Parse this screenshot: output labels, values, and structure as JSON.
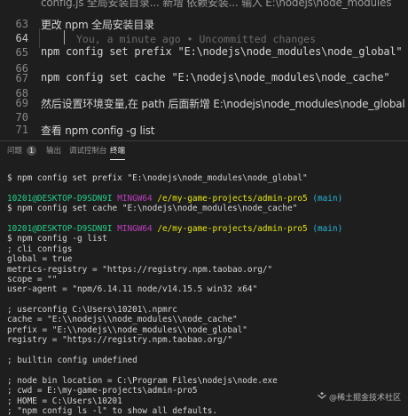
{
  "editor": {
    "top_partial": "config.js  全局安装目录... 新增  依赖安装... 输入 E:\\nodejs\\node_modules",
    "lines": [
      {
        "num": "63",
        "text": "更改 npm 全局安装目录",
        "active": false
      },
      {
        "num": "64",
        "text": "",
        "active": true
      },
      {
        "num": "65",
        "text": "npm config set prefix \"E:\\nodejs\\node_modules\\node_global\"",
        "active": false
      },
      {
        "num": "66",
        "text": "",
        "active": false
      },
      {
        "num": "67",
        "text": "npm config set cache \"E:\\nodejs\\node_modules\\node_cache\"",
        "active": false
      },
      {
        "num": "68",
        "text": "",
        "active": false
      },
      {
        "num": "69",
        "text": "然后设置环境变量,在 path 后面新增 E:\\nodejs\\node_modules\\node_global",
        "active": false
      },
      {
        "num": "70",
        "text": "",
        "active": false
      },
      {
        "num": "71",
        "text": "查看 npm config -g list",
        "active": false
      }
    ],
    "blame": "You, a minute ago • Uncommitted changes"
  },
  "panel": {
    "tabs": [
      {
        "label": "问题"
      },
      {
        "label": "输出"
      },
      {
        "label": "调试控制台"
      },
      {
        "label": "终端"
      }
    ],
    "problems_count": "1"
  },
  "terminal": {
    "cmd1": "$ npm config set prefix \"E:\\nodejs\\node_modules\\node_global\"",
    "prompt_user": "10201@DESKTOP-D9SDN9I",
    "prompt_shell": "MINGW64",
    "prompt_path": "/e/my-game-projects/admin-pro5",
    "prompt_branch": "(main)",
    "cmd2": "$ npm config set cache \"E:\\nodejs\\node_modules\\node_cache\"",
    "cmd3": "$ npm config -g list",
    "output": [
      "; cli configs",
      "global = true",
      "metrics-registry = \"https://registry.npm.taobao.org/\"",
      "scope = \"\"",
      "user-agent = \"npm/6.14.11 node/v14.15.5 win32 x64\"",
      "",
      "; userconfig C:\\Users\\10201\\.npmrc",
      "cache = \"E:\\\\nodejs\\\\node_modules\\\\node_cache\"",
      "prefix = \"E:\\\\nodejs\\\\node_modules\\\\node_global\"",
      "registry = \"https://registry.npm.taobao.org/\"",
      "",
      "; builtin config undefined",
      "",
      "; node bin location = C:\\Program Files\\nodejs\\node.exe",
      "; cwd = E:\\my-game-projects\\admin-pro5",
      "; HOME = C:\\Users\\10201",
      "; \"npm config ls -l\" to show all defaults."
    ]
  },
  "watermark": "@稀土掘金技术社区"
}
